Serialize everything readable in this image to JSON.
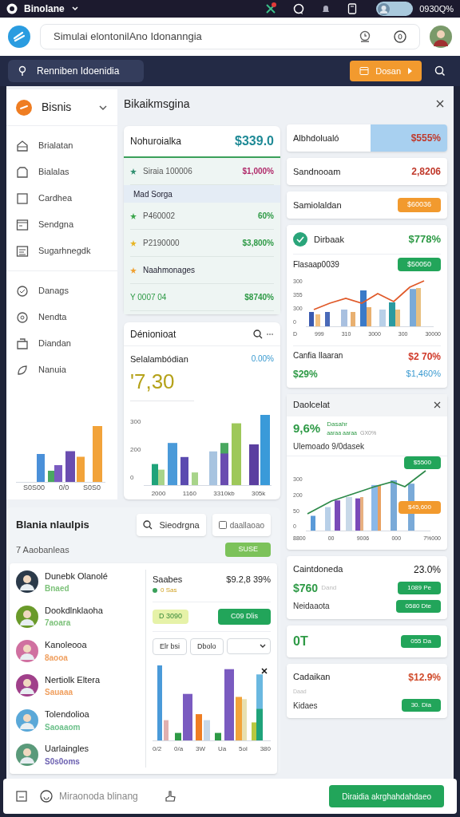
{
  "status_bar": {
    "app_name": "Binolane",
    "battery": "0930Q%"
  },
  "header": {
    "search": {
      "value": "Simulai elontonilAno Idonanngia"
    }
  },
  "toolbar": {
    "location": "Renniben Idoenidia",
    "button": "Dosan"
  },
  "sidebar": {
    "title": "Bisnis",
    "items": [
      {
        "label": "Brialatan"
      },
      {
        "label": "Bialalas"
      },
      {
        "label": "Cardhea"
      },
      {
        "label": "Sendgna"
      },
      {
        "label": "Sugarhnegdk"
      }
    ],
    "items_2": [
      {
        "label": "Danags"
      },
      {
        "label": "Nendta"
      },
      {
        "label": "Diandan"
      },
      {
        "label": "Nanuia"
      }
    ],
    "chart": {
      "x_labels": [
        "S0S00",
        "0/0",
        "S0S0"
      ]
    }
  },
  "panel": {
    "title": "Bikaikmsgina"
  },
  "summary_card": {
    "title": "Nohuroialka",
    "value": "$339.0",
    "rows": [
      {
        "kind": "row",
        "label": "Siraia 100006",
        "value": "$1,000%",
        "color": "#b02a6a"
      },
      {
        "kind": "heading",
        "label": "Mad Sorga"
      },
      {
        "kind": "row",
        "label": "P460002",
        "value": "60%",
        "color": "#2e9a46"
      },
      {
        "kind": "row",
        "label": "P2190000",
        "value": "$3,800%",
        "color": "#2e9a46"
      },
      {
        "kind": "note",
        "label": "Naahmonages"
      },
      {
        "kind": "total",
        "label": "Y 0007 04",
        "value": "$8740%",
        "color": "#2e9a46"
      }
    ]
  },
  "stats_card": {
    "title": "Dénionioat",
    "subtitle": "Selalambódian",
    "change": "0.00%",
    "value": "'7,30",
    "chart": {
      "y_labels": [
        "300",
        "200",
        "0"
      ],
      "x_labels": [
        "2000",
        "1160",
        "3310kb",
        "305k"
      ]
    }
  },
  "metric_cards": [
    {
      "kind": "highlight",
      "label": "Albhdolualó",
      "value": "$555%"
    },
    {
      "kind": "plain",
      "label": "Sandnooam",
      "value": "2,8206"
    },
    {
      "kind": "badge",
      "label": "Samiolaldan",
      "value": "$60036"
    }
  ],
  "growth_card": {
    "title": "Dirbaak",
    "value": "$778%",
    "subtitle": "Flasaap0039",
    "badge": "$50050",
    "chart": {
      "y_labels": [
        "300",
        "355",
        "300",
        "0"
      ],
      "x_labels": [
        "D",
        "999",
        "310",
        "3000",
        "300",
        "30000"
      ]
    },
    "footer_label": "Canfia Ilaaran",
    "footer_value": "$2 70%",
    "stat_a": "$29%",
    "stat_b": "$1,460%"
  },
  "forecast_card": {
    "title": "Daolcelat",
    "value": "9,6%",
    "note_top": "Dasahr",
    "note": "aaraa aaraa",
    "note_muted": "GX0%",
    "subtitle": "Ulemoado 9/0dasek",
    "chart": {
      "y_labels": [
        "300",
        "200",
        "50",
        "0"
      ],
      "x_labels": [
        "8800",
        "00",
        "9006",
        "000",
        "7%000"
      ],
      "badges": [
        "$5500",
        "$45,600"
      ]
    }
  },
  "rate_card": {
    "title": "Caintdoneda",
    "value": "23.0%",
    "amount": "$760",
    "amount_note": "Dand",
    "amount_badge": "1089 Pe",
    "row_label": "Neidaaota",
    "row_badge": "0580 Dte"
  },
  "ot_card": {
    "value": "0T",
    "badge": "055 Da"
  },
  "cad_card": {
    "title": "Cadaikan",
    "value": "$12.9%",
    "note": "Daad",
    "row_label": "Kidaes",
    "row_badge": "30. Dia"
  },
  "team_panel": {
    "title": "Blania nlaulpis",
    "search": "Sieodrgna",
    "filter": {
      "label": "daallaoao",
      "checked": false
    },
    "count": "7 Aaobanleas",
    "count_badge": "SUSE",
    "members": [
      {
        "name": "Dunebk Olanolé",
        "role": "Bnaed",
        "color": "#7dc27a"
      },
      {
        "name": "Dookdlnklaoha",
        "role": "7aoara",
        "color": "#7dc27a"
      },
      {
        "name": "Kanoleooa",
        "role": "8aooa",
        "color": "#f0a060"
      },
      {
        "name": "Nertiolk Eltera",
        "role": "Sauaaa",
        "color": "#f0a060"
      },
      {
        "name": "Tolendolioa",
        "role": "Saoaaom",
        "color": "#6cc08a"
      },
      {
        "name": "Uarlaingles",
        "role": "S0s0oms",
        "color": "#6a5fb0"
      }
    ],
    "detail": {
      "label": "Saabes",
      "value": "$9.2,8 39%",
      "status": "0 Sas",
      "chip": "D 3090",
      "button": "C09 Dlis",
      "filters": [
        "Elr bsi",
        "Dbolo"
      ]
    },
    "chart": {
      "x_labels": [
        "0/2",
        "0/a",
        "3W",
        "Ua",
        "5ol",
        "380"
      ]
    }
  },
  "bottom_bar": {
    "placeholder": "Miraonoda blinang",
    "button": "Diraidia akrghahdahdaeo"
  }
}
